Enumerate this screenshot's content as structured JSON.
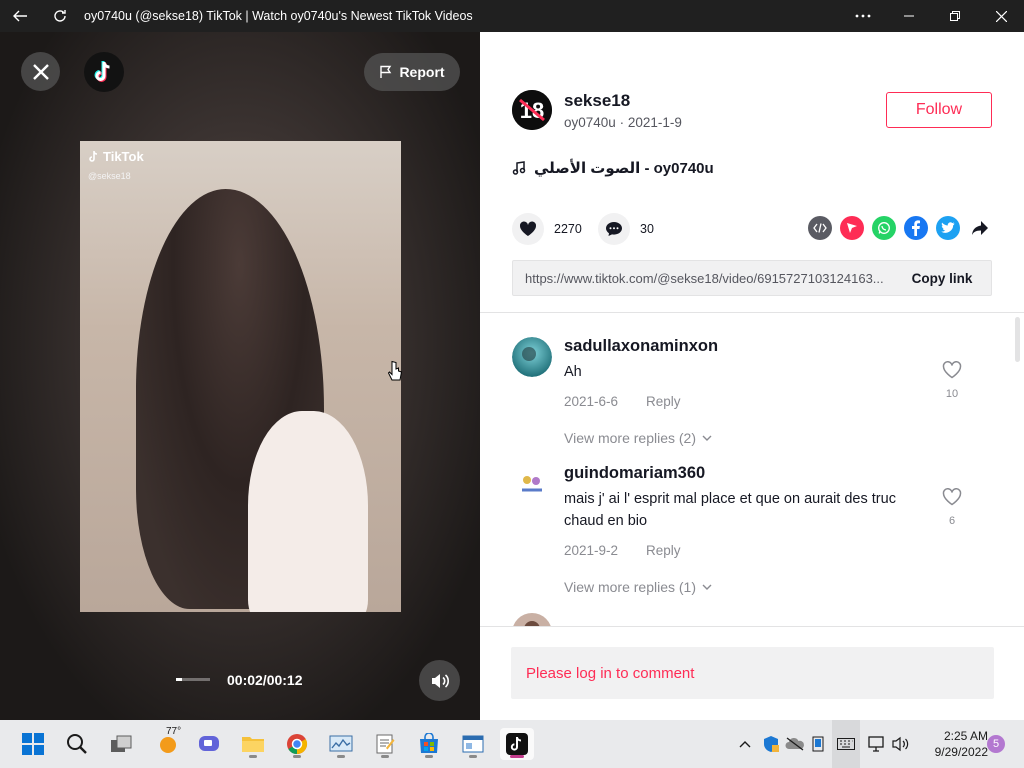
{
  "window": {
    "title": "oy0740u (@sekse18) TikTok | Watch oy0740u's Newest TikTok Videos",
    "back_icon": "back-arrow-icon",
    "refresh_icon": "refresh-icon",
    "more_icon": "more-horizontal-icon"
  },
  "video": {
    "report_label": "Report",
    "watermark_brand": "TikTok",
    "watermark_user": "@sekse18",
    "time": "00:02/00:12",
    "progress_fraction": 0.17
  },
  "author": {
    "username": "sekse18",
    "nickname": "oy0740u",
    "date": "2021-1-9",
    "follow_label": "Follow"
  },
  "music": {
    "title": "الصوت الأصلي - oy0740u"
  },
  "stats": {
    "likes": "2270",
    "comments": "30"
  },
  "share": {
    "icons": [
      "embed-icon",
      "send-icon",
      "whatsapp-icon",
      "facebook-icon",
      "twitter-icon",
      "share-arrow-icon"
    ],
    "colors": {
      "embed": "#5a5b63",
      "send": "#fe2c55",
      "whatsapp": "#25d366",
      "facebook": "#1877f2",
      "twitter": "#1da1f2"
    }
  },
  "link": {
    "url": "https://www.tiktok.com/@sekse18/video/6915727103124163...",
    "copy_label": "Copy link"
  },
  "comments": [
    {
      "username": "sadullaxonaminxon",
      "text": "Ah",
      "date": "2021-6-6",
      "reply_label": "Reply",
      "likes": "10",
      "view_more": "View more replies (2)"
    },
    {
      "username": "guindomariam360",
      "text": "mais j' ai l' esprit mal place et que on aurait des truc chaud en bio",
      "date": "2021-9-2",
      "reply_label": "Reply",
      "likes": "6",
      "view_more": "View more replies (1)"
    }
  ],
  "login_prompt": "Please log in to comment",
  "taskbar": {
    "weather": "77°",
    "time": "2:25 AM",
    "date": "9/29/2022",
    "notifications": "5"
  },
  "colors": {
    "accent": "#fe2c55",
    "text": "#161823"
  }
}
